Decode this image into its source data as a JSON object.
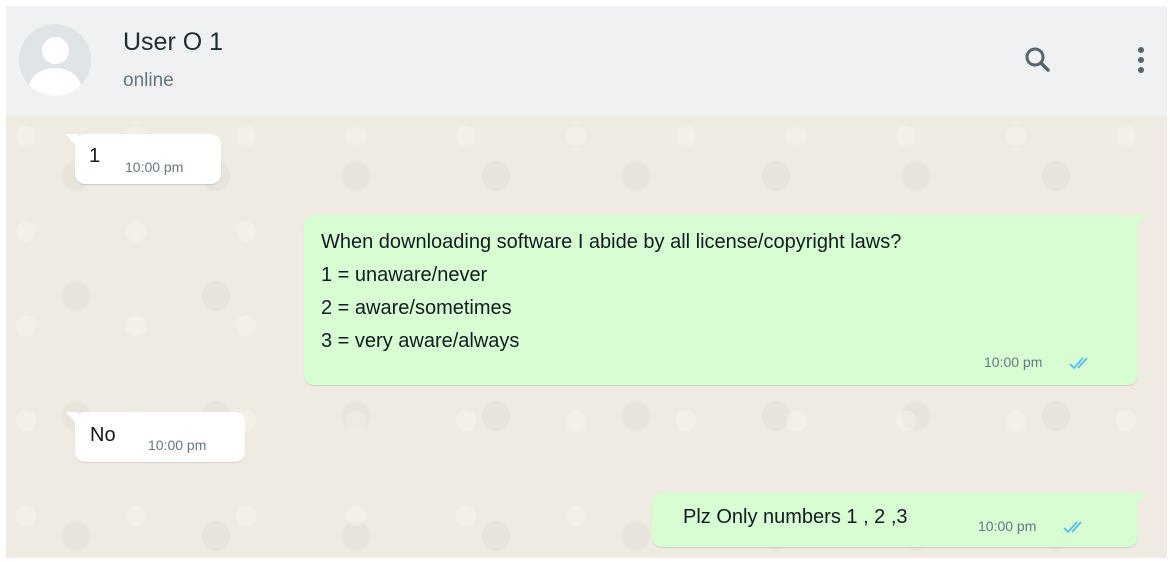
{
  "header": {
    "contact_name": "User O 1",
    "status": "online",
    "icons": [
      "avatar-icon",
      "search-icon",
      "more-options-icon"
    ]
  },
  "messages": [
    {
      "direction": "incoming",
      "text": "1",
      "time": "10:00 pm"
    },
    {
      "direction": "outgoing",
      "lines": [
        "When downloading software I abide by all license/copyright laws?",
        "1 = unaware/never",
        "2 = aware/sometimes",
        "3 = very aware/always"
      ],
      "time": "10:00 pm",
      "ticks": "read"
    },
    {
      "direction": "incoming",
      "text": "No",
      "time": "10:00 pm"
    },
    {
      "direction": "outgoing",
      "text": "Plz Only numbers 1 , 2 ,3",
      "time": "10:00 pm",
      "ticks": "read"
    }
  ],
  "colors": {
    "header_bg": "#eff1f3",
    "chat_bg": "#efeae2",
    "incoming_bubble": "#ffffff",
    "outgoing_bubble": "#d9fdd3",
    "read_ticks": "#53bdeb",
    "icon": "#54656f"
  }
}
